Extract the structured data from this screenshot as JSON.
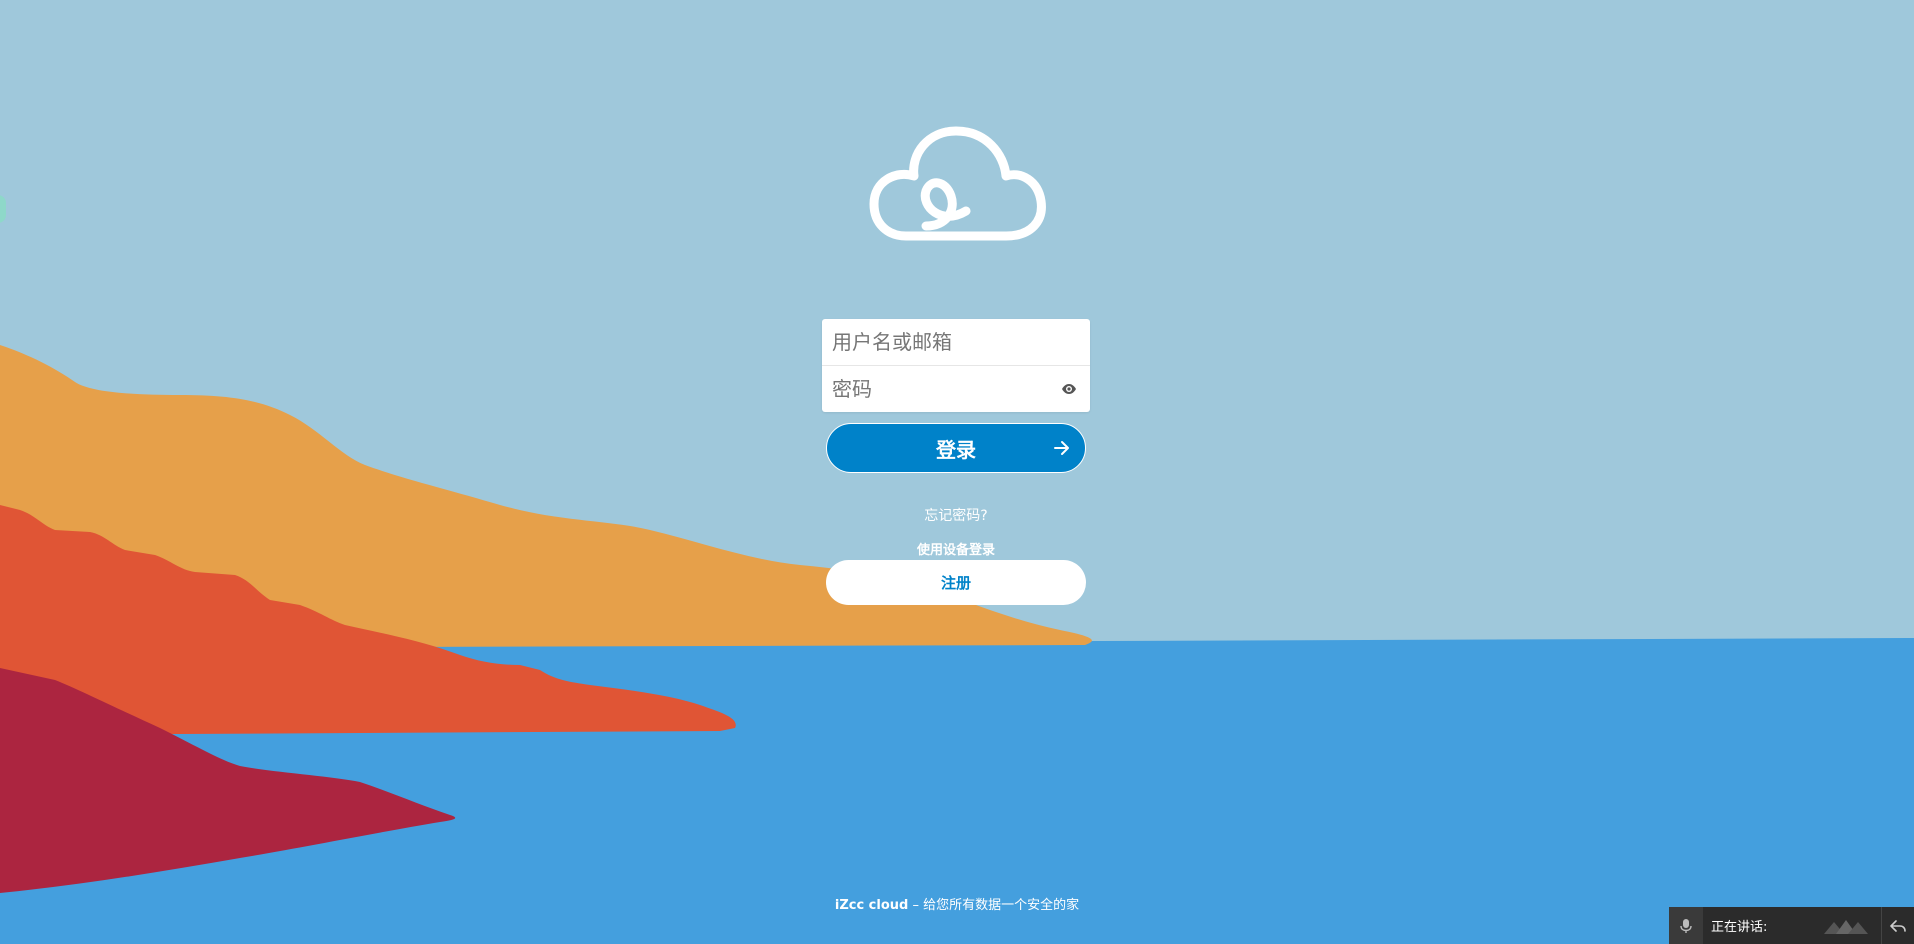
{
  "colors": {
    "sky": "#9fc8db",
    "sea": "#449fde",
    "hill_orange": "#e6a04a",
    "hill_red": "#e05535",
    "hill_crimson": "#ac2540",
    "accent": "#0082c9"
  },
  "logo": {
    "icon": "cloud-icon"
  },
  "login": {
    "username_placeholder": "用户名或邮箱",
    "password_placeholder": "密码",
    "show_password_icon": "eye-icon",
    "submit_label": "登录",
    "submit_icon": "arrow-right-icon"
  },
  "links": {
    "forgot_password": "忘记密码?",
    "device_login": "使用设备登录"
  },
  "register": {
    "label": "注册"
  },
  "footer": {
    "brand": "iZcc cloud",
    "separator": " – ",
    "slogan": "给您所有数据一个安全的家"
  },
  "speak_bar": {
    "mic_icon": "mic-icon",
    "label": "正在讲话:",
    "reply_icon": "reply-icon"
  }
}
